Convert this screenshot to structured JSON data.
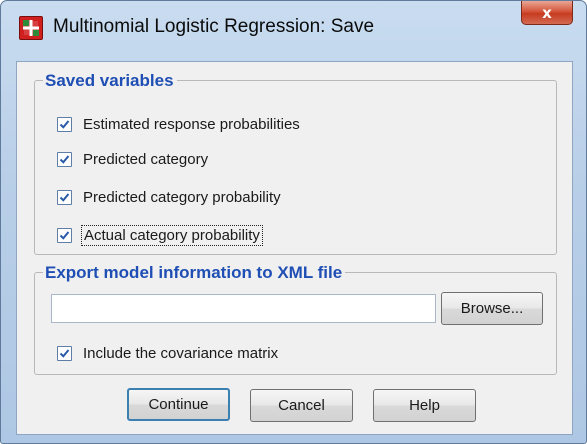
{
  "window": {
    "title": "Multinomial Logistic Regression: Save",
    "close_glyph": "x"
  },
  "saved_variables": {
    "title": "Saved variables",
    "items": [
      {
        "label": "Estimated response probabilities",
        "checked": true
      },
      {
        "label": "Predicted category",
        "checked": true
      },
      {
        "label": "Predicted category probability",
        "checked": true
      },
      {
        "label": "Actual category probability",
        "checked": true
      }
    ]
  },
  "export": {
    "title": "Export model information to XML file",
    "file_value": "",
    "browse_label": "Browse...",
    "covariance_label": "Include the covariance matrix",
    "covariance_checked": true
  },
  "buttons": {
    "continue": "Continue",
    "cancel": "Cancel",
    "help": "Help"
  },
  "icons": {
    "app": "spss-app-icon",
    "close": "close-icon",
    "check": "checkmark-icon"
  },
  "colors": {
    "group_title": "#1f4fb4",
    "checkmark": "#2b5aa8",
    "close_button": "#c63b20"
  }
}
